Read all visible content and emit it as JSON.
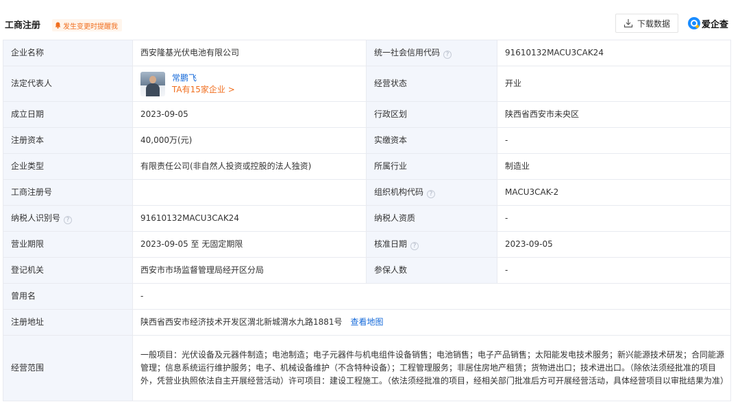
{
  "header": {
    "title": "工商注册",
    "notify_label": "发生变更时提醒我",
    "download_label": "下载数据",
    "brand_name": "爱企查"
  },
  "colors": {
    "label_bg": "#f3f6fc",
    "border": "#e8eaf0",
    "link": "#1469d9",
    "accent_orange": "#f06e1e",
    "brand_blue": "#1a8cff"
  },
  "rows": {
    "name_label": "企业名称",
    "name_value": "西安隆基光伏电池有限公司",
    "credit_label": "统一社会信用代码",
    "credit_value": "91610132MACU3CAK24",
    "rep_label": "法定代表人",
    "rep_name": "常鹏飞",
    "rep_count": "TA有15家企业 >",
    "status_label": "经营状态",
    "status_value": "开业",
    "founded_label": "成立日期",
    "founded_value": "2023-09-05",
    "region_label": "行政区划",
    "region_value": "陕西省西安市未央区",
    "capital_label": "注册资本",
    "capital_value": "40,000万(元)",
    "paid_label": "实缴资本",
    "paid_value": "-",
    "type_label": "企业类型",
    "type_value": "有限责任公司(非自然人投资或控股的法人独资)",
    "industry_label": "所属行业",
    "industry_value": "制造业",
    "regno_label": "工商注册号",
    "regno_value": "",
    "orgcode_label": "组织机构代码",
    "orgcode_value": "MACU3CAK-2",
    "taxid_label": "纳税人识别号",
    "taxid_value": "91610132MACU3CAK24",
    "taxqual_label": "纳税人资质",
    "taxqual_value": "-",
    "term_label": "营业期限",
    "term_value": "2023-09-05 至 无固定期限",
    "approve_label": "核准日期",
    "approve_value": "2023-09-05",
    "authority_label": "登记机关",
    "authority_value": "西安市市场监督管理局经开区分局",
    "insured_label": "参保人数",
    "insured_value": "-",
    "formername_label": "曾用名",
    "formername_value": "-",
    "address_label": "注册地址",
    "address_value": "陕西省西安市经济技术开发区渭北新城渭水九路1881号",
    "map_link": "查看地图",
    "scope_label": "经营范围",
    "scope_value": "一般项目：光伏设备及元器件制造；电池制造；电子元器件与机电组件设备销售；电池销售；电子产品销售；太阳能发电技术服务；新兴能源技术研发；合同能源管理；信息系统运行维护服务；电子、机械设备维护（不含特种设备）；工程管理服务；非居住房地产租赁；货物进出口；技术进出口。（除依法须经批准的项目外，凭营业执照依法自主开展经营活动）许可项目：建设工程施工。（依法须经批准的项目，经相关部门批准后方可开展经营活动，具体经营项目以审批结果为准）"
  },
  "icons": {
    "help": "question-circle-icon",
    "bell": "bell-icon",
    "download": "download-icon"
  }
}
